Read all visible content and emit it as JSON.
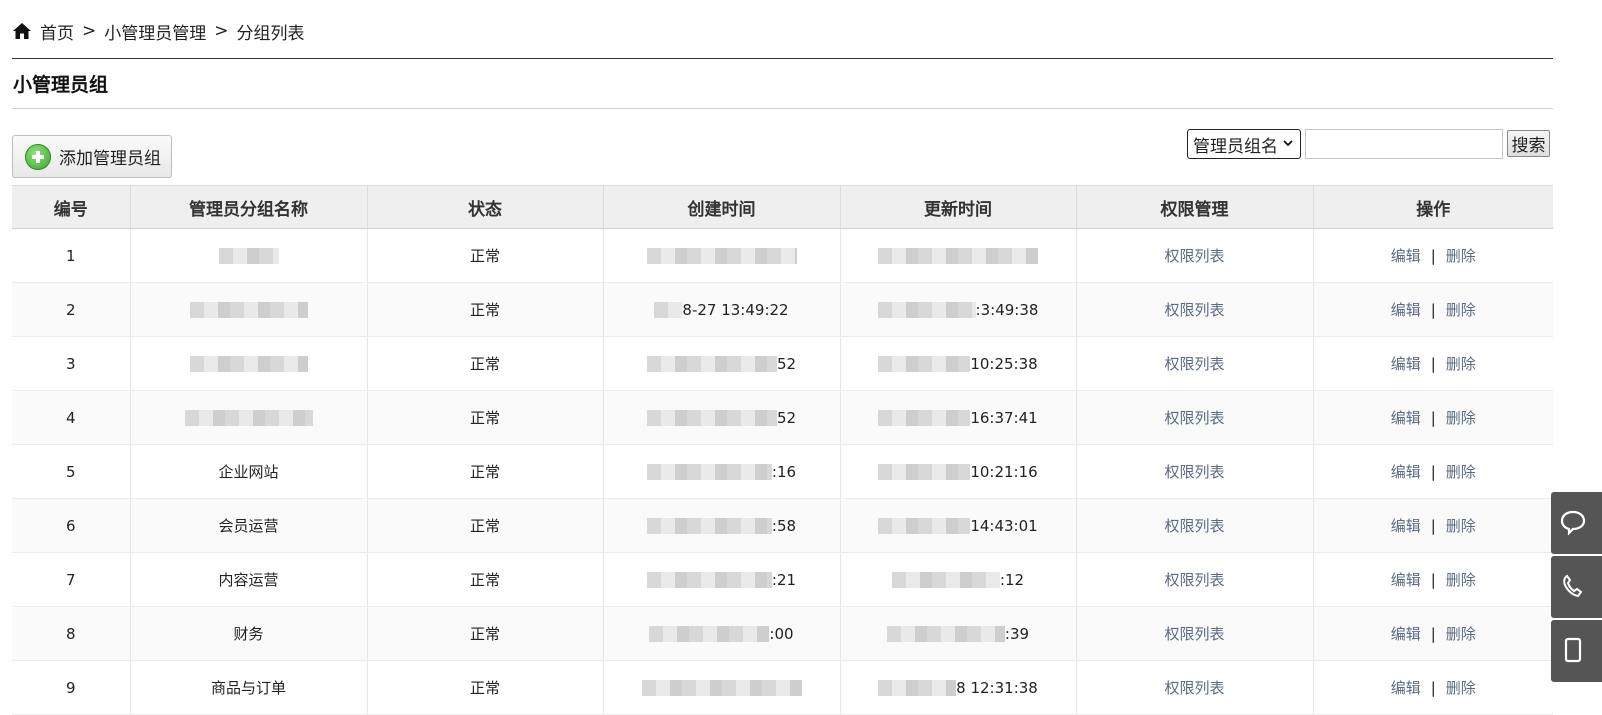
{
  "breadcrumb": {
    "home": "首页",
    "sep": ">",
    "section": "小管理员管理",
    "page": "分组列表"
  },
  "page_title": "小管理员组",
  "toolbar": {
    "add_label": "添加管理员组"
  },
  "search": {
    "select_value": "管理员组名",
    "input_value": "",
    "button_label": "搜索"
  },
  "table": {
    "headers": [
      "编号",
      "管理员分组名称",
      "状态",
      "创建时间",
      "更新时间",
      "权限管理",
      "操作"
    ],
    "rows": [
      {
        "id": "1",
        "name": "",
        "status": "正常",
        "created": "",
        "updated": "",
        "perm": "权限列表",
        "edit": "编辑",
        "sep": "|",
        "del": "删除"
      },
      {
        "id": "2",
        "name": "",
        "status": "正常",
        "created": "8-27 13:49:22",
        "updated": ":3:49:38",
        "perm": "权限列表",
        "edit": "编辑",
        "sep": "|",
        "del": "删除"
      },
      {
        "id": "3",
        "name": "",
        "status": "正常",
        "created": "52",
        "updated": "10:25:38",
        "perm": "权限列表",
        "edit": "编辑",
        "sep": "|",
        "del": "删除"
      },
      {
        "id": "4",
        "name": "",
        "status": "正常",
        "created": "52",
        "updated": "16:37:41",
        "perm": "权限列表",
        "edit": "编辑",
        "sep": "|",
        "del": "删除"
      },
      {
        "id": "5",
        "name": "企业网站",
        "status": "正常",
        "created": ":16",
        "updated": "10:21:16",
        "perm": "权限列表",
        "edit": "编辑",
        "sep": "|",
        "del": "删除"
      },
      {
        "id": "6",
        "name": "会员运营",
        "status": "正常",
        "created": ":58",
        "updated": "14:43:01",
        "perm": "权限列表",
        "edit": "编辑",
        "sep": "|",
        "del": "删除"
      },
      {
        "id": "7",
        "name": "内容运营",
        "status": "正常",
        "created": ":21",
        "updated": ":12",
        "perm": "权限列表",
        "edit": "编辑",
        "sep": "|",
        "del": "删除"
      },
      {
        "id": "8",
        "name": "财务",
        "status": "正常",
        "created": ":00",
        "updated": ":39",
        "perm": "权限列表",
        "edit": "编辑",
        "sep": "|",
        "del": "删除"
      },
      {
        "id": "9",
        "name": "商品与订单",
        "status": "正常",
        "created": "",
        "updated": "8 12:31:38",
        "perm": "权限列表",
        "edit": "编辑",
        "sep": "|",
        "del": "删除"
      }
    ]
  },
  "icons": {
    "home": "home-icon",
    "add": "plus-circle-icon",
    "select": "chevron-down-icon"
  },
  "colors": {
    "link": "#5b6b85",
    "header_bg": "#efefef",
    "side_tab": "#555555"
  }
}
